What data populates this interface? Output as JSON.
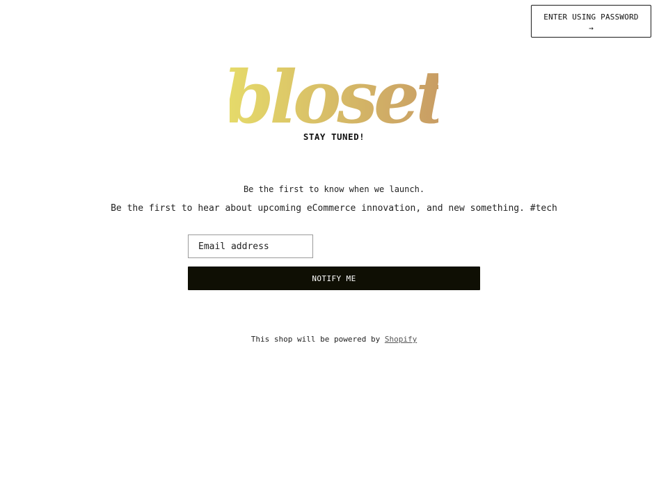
{
  "header": {
    "password_button_label": "ENTER USING PASSWORD",
    "password_button_arrow": "→"
  },
  "logo": {
    "text": "bloset",
    "gradient_start": "#e6dc6a",
    "gradient_end": "#c79a64"
  },
  "hero": {
    "tagline": "STAY TUNED!",
    "launch_text": "Be the first to know when we launch.",
    "description": "Be the first to hear about upcoming eCommerce innovation, and new something. #tech"
  },
  "signup": {
    "email_placeholder": "Email address",
    "notify_button_label": "NOTIFY ME"
  },
  "footer": {
    "powered_prefix": "This shop will be powered by",
    "powered_link": "Shopify"
  },
  "colors": {
    "button_background": "#0f0f04",
    "text": "#111111"
  }
}
